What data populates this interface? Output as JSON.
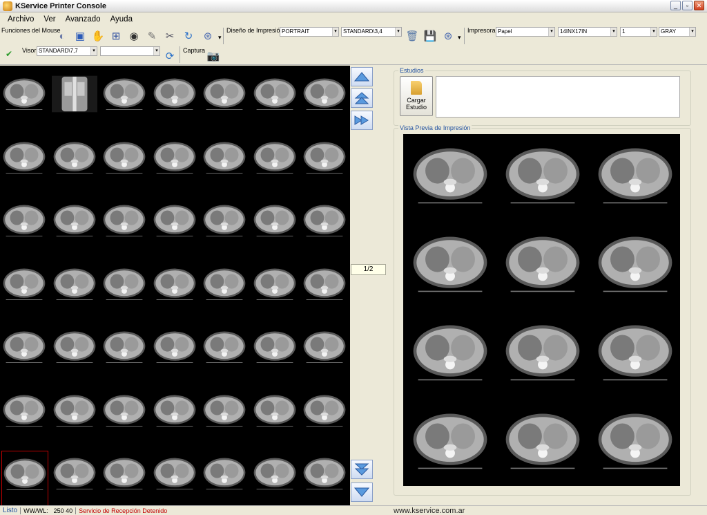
{
  "window": {
    "title": "KService Printer Console"
  },
  "menu": [
    "Archivo",
    "Ver",
    "Avanzado",
    "Ayuda"
  ],
  "toolbar": {
    "mouse_functions_label": "Funciones del Mouse",
    "layout_label": "Diseño de Impresión",
    "orientation": "PORTRAIT",
    "print_layout": "STANDARD\\3,4",
    "printer_label": "Impresora",
    "media": "Papel",
    "film_size": "14INX17IN",
    "copies": "1",
    "color_mode": "GRAY",
    "viewer_label": "Visor",
    "viewer_layout": "STANDARD\\7,7",
    "viewer_extra": "",
    "capture_label": "Captura"
  },
  "navigation": {
    "page_indicator": "1/2"
  },
  "studies": {
    "group_title": "Estudios",
    "load_button": "Cargar Estudio"
  },
  "preview": {
    "group_title": "Vista Previa de Impresión"
  },
  "status": {
    "state": "Listo",
    "wwwl_label": "WW/WL:",
    "wwwl_value": "250  40",
    "service": "Servicio de Recepción Detenido",
    "url": "www.kservice.com.ar"
  },
  "colors": {
    "accent_blue": "#2050a0",
    "alert_red": "#c00000",
    "selection_border": "#c00000"
  }
}
